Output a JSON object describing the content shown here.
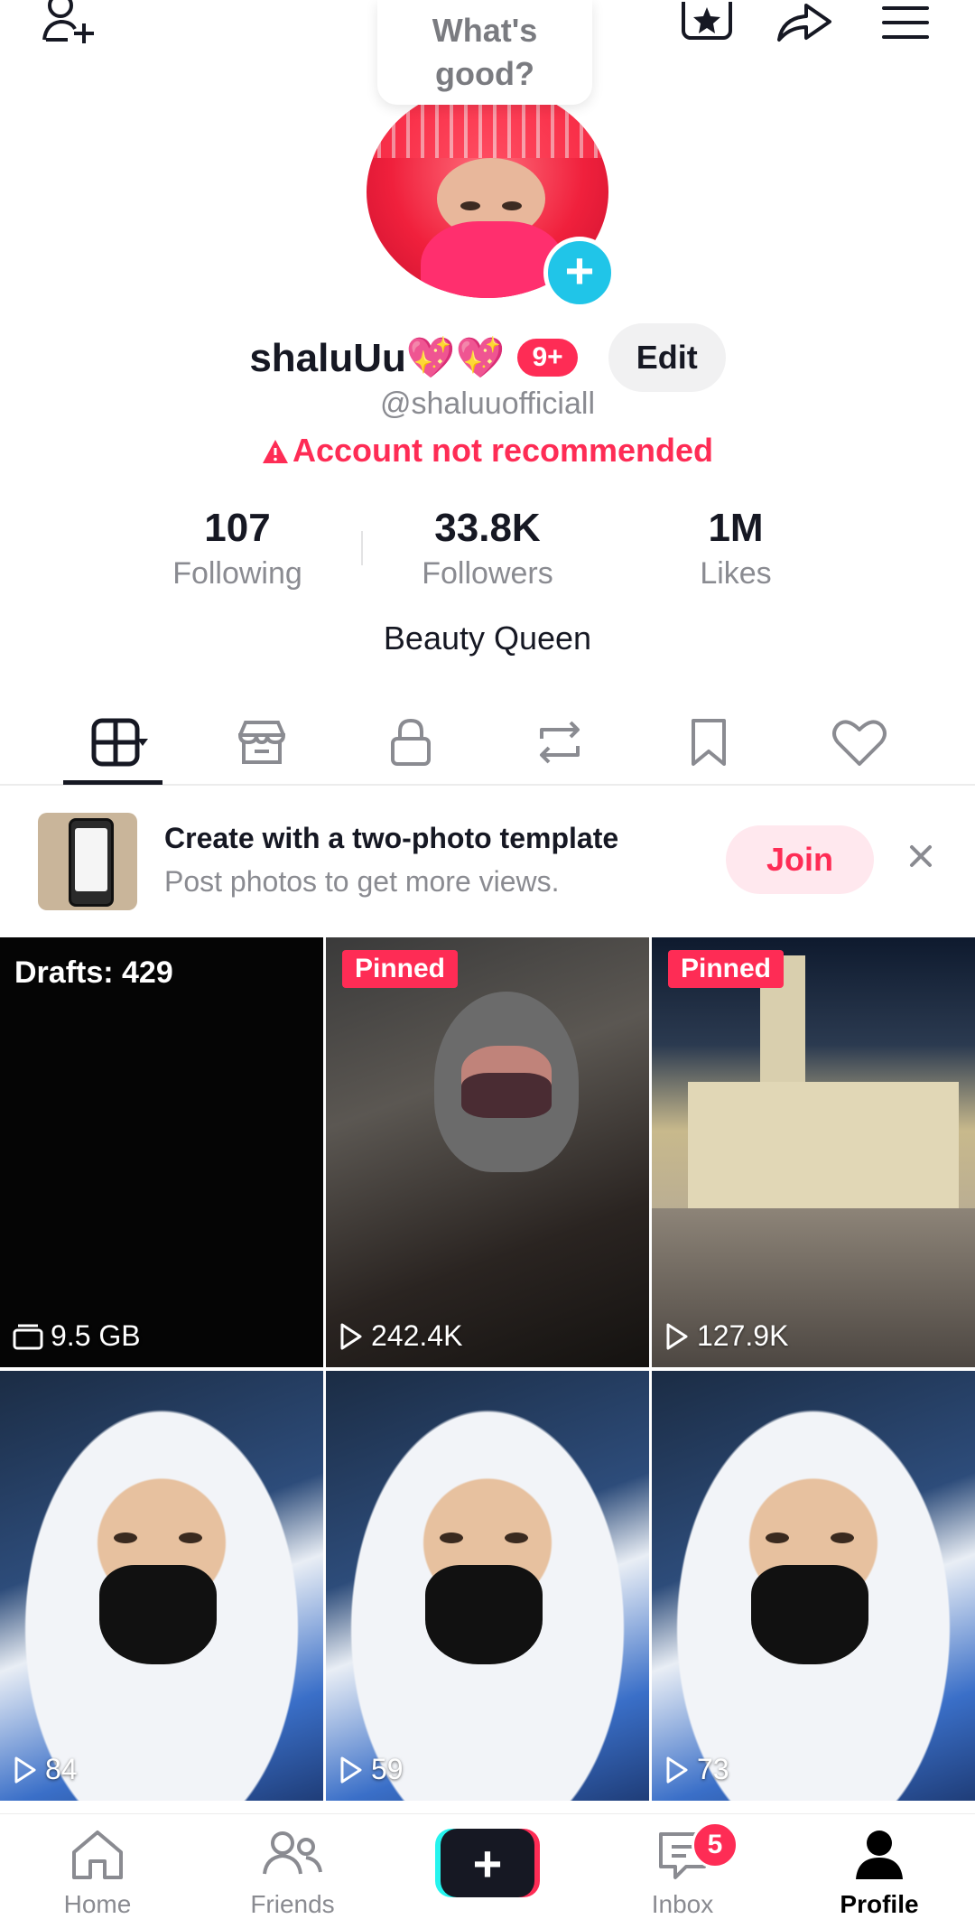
{
  "header": {
    "add_friend_icon": "person-plus-icon",
    "status_bubble": "What's good?",
    "star_icon": "favorites-icon",
    "share_icon": "share-icon",
    "menu_icon": "menu-icon"
  },
  "profile": {
    "username": "shaluUu💖💖",
    "notification_badge": "9+",
    "edit_label": "Edit",
    "handle": "@shaluuofficiall",
    "warning": "Account not recommended",
    "bio": "Beauty Queen"
  },
  "stats": [
    {
      "value": "107",
      "label": "Following"
    },
    {
      "value": "33.8K",
      "label": "Followers"
    },
    {
      "value": "1M",
      "label": "Likes"
    }
  ],
  "tabs": [
    {
      "icon": "grid-icon"
    },
    {
      "icon": "shop-icon"
    },
    {
      "icon": "lock-icon"
    },
    {
      "icon": "repost-icon"
    },
    {
      "icon": "bookmark-icon"
    },
    {
      "icon": "heart-icon"
    }
  ],
  "promo": {
    "title": "Create with a two-photo template",
    "subtitle": "Post photos to get more views.",
    "join_label": "Join"
  },
  "grid": {
    "drafts_label": "Drafts: 429",
    "drafts_size": "9.5 GB",
    "pinned_label": "Pinned",
    "videos": [
      {
        "views": "242.4K"
      },
      {
        "views": "127.9K"
      },
      {
        "views": "84"
      },
      {
        "views": "59"
      },
      {
        "views": "73"
      }
    ]
  },
  "bottom_nav": {
    "items": [
      {
        "label": "Home",
        "icon": "home-icon"
      },
      {
        "label": "Friends",
        "icon": "friends-icon"
      },
      {
        "label": "",
        "icon": "plus-icon"
      },
      {
        "label": "Inbox",
        "icon": "inbox-icon",
        "badge": "5"
      },
      {
        "label": "Profile",
        "icon": "profile-icon"
      }
    ]
  },
  "colors": {
    "accent": "#fe2c55",
    "cyan": "#25f4ee",
    "text": "#161823",
    "muted": "#8a8b91"
  }
}
